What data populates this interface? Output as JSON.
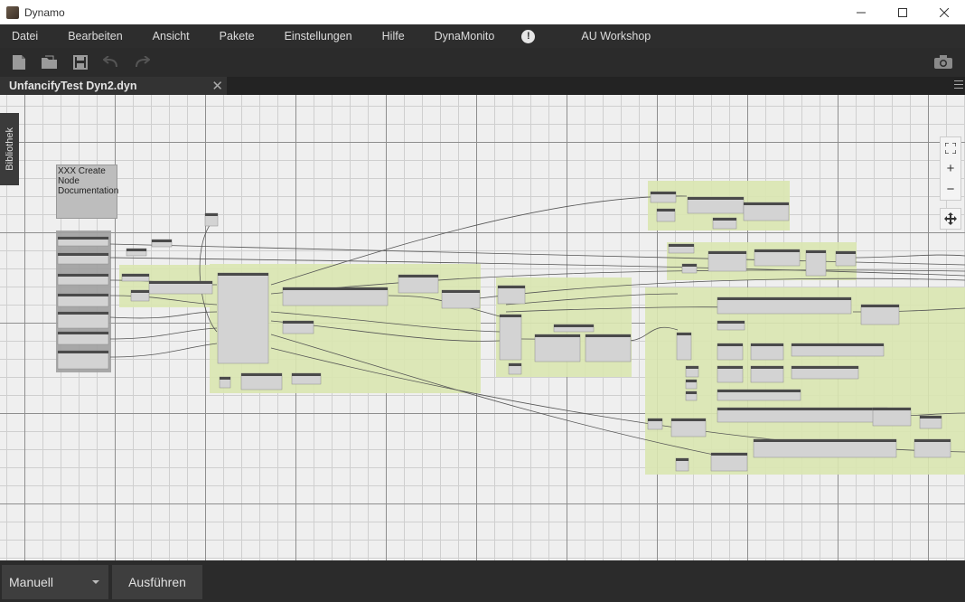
{
  "window": {
    "title": "Dynamo"
  },
  "menu": {
    "items": [
      "Datei",
      "Bearbeiten",
      "Ansicht",
      "Pakete",
      "Einstellungen",
      "Hilfe",
      "DynaMonito"
    ],
    "info_glyph": "!",
    "extra_item": "AU Workshop"
  },
  "toolbar": {
    "icons": [
      "new-file-icon",
      "open-folder-icon",
      "save-icon",
      "undo-icon",
      "redo-icon"
    ],
    "right_icon": "camera-icon"
  },
  "tab": {
    "label": "UnfancifyTest Dyn2.dyn",
    "close_glyph": "✕"
  },
  "library": {
    "label": "Bibliothek"
  },
  "note": {
    "text": "XXX Create Node Documentation"
  },
  "zoom": {
    "fit_glyph": "⛶",
    "zoom_in": "+",
    "zoom_out": "−",
    "pan_glyph": "✥"
  },
  "bottom": {
    "run_mode": "Manuell",
    "run_button": "Ausführen"
  },
  "colors": {
    "group_fill": "#d9e6b0",
    "node_body": "#d3d3d3",
    "node_header": "#4a4a4a",
    "canvas_bg": "#efefef"
  }
}
